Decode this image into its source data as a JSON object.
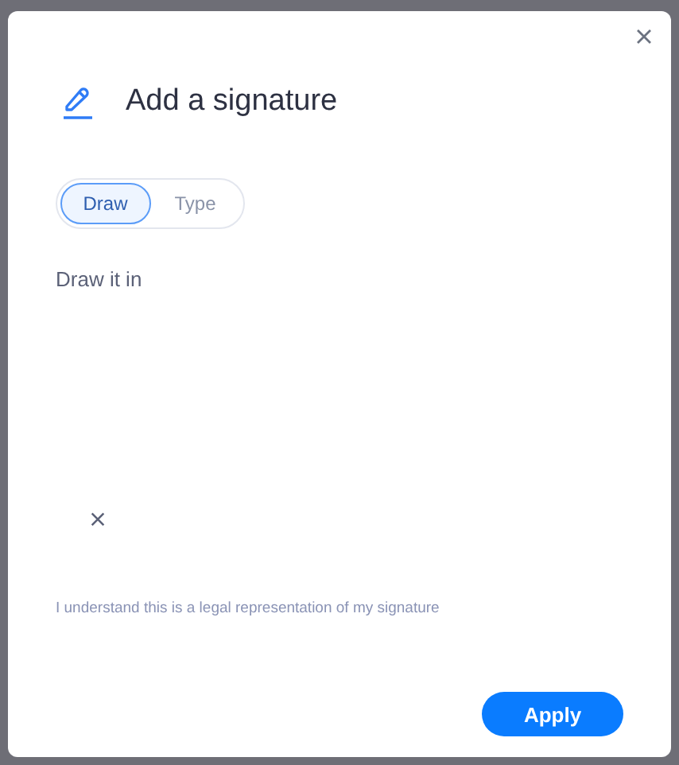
{
  "dialog": {
    "title": "Add a signature"
  },
  "tabs": [
    {
      "label": "Draw",
      "selected": true
    },
    {
      "label": "Type",
      "selected": false
    }
  ],
  "draw_prompt": "Draw it in",
  "disclaimer": "I understand this is a legal representation of my signature",
  "apply_button": "Apply"
}
